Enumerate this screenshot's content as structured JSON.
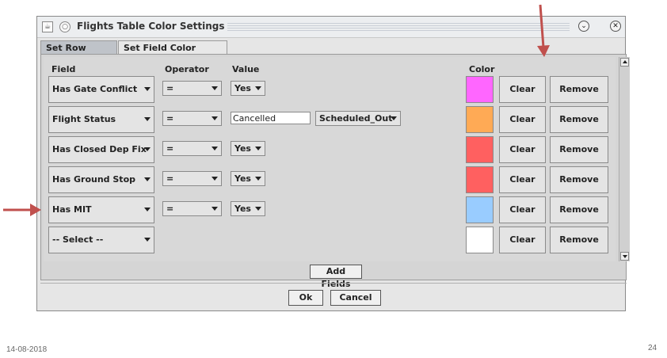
{
  "window": {
    "title": "Flights Table Color Settings"
  },
  "tabs": [
    "Set Row Colors",
    "Set Field Color Alerts"
  ],
  "headers": {
    "field": "Field",
    "operator": "Operator",
    "value": "Value",
    "color": "Color"
  },
  "rows": [
    {
      "field": "Has Gate Conflict",
      "operator": "=",
      "value": "Yes",
      "color": "#ff66ff",
      "clear": "Clear",
      "remove": "Remove"
    },
    {
      "field": "Flight Status",
      "operator": "=",
      "value_text": "Cancelled",
      "value_select": "Scheduled_Out",
      "color": "#ffaa55",
      "clear": "Clear",
      "remove": "Remove"
    },
    {
      "field": "Has Closed Dep Fix",
      "operator": "=",
      "value": "Yes",
      "color": "#ff6060",
      "clear": "Clear",
      "remove": "Remove"
    },
    {
      "field": "Has Ground Stop",
      "operator": "=",
      "value": "Yes",
      "color": "#ff6060",
      "clear": "Clear",
      "remove": "Remove"
    },
    {
      "field": "Has MIT",
      "operator": "=",
      "value": "Yes",
      "color": "#99ccff",
      "clear": "Clear",
      "remove": "Remove"
    },
    {
      "field": "-- Select --",
      "color": "#ffffff",
      "clear": "Clear",
      "remove": "Remove"
    }
  ],
  "buttons": {
    "add_fields": "Add Fields",
    "ok": "Ok",
    "cancel": "Cancel"
  },
  "footer": {
    "date": "14-08-2018",
    "page": "24"
  },
  "annotation_color": "#c0504d"
}
